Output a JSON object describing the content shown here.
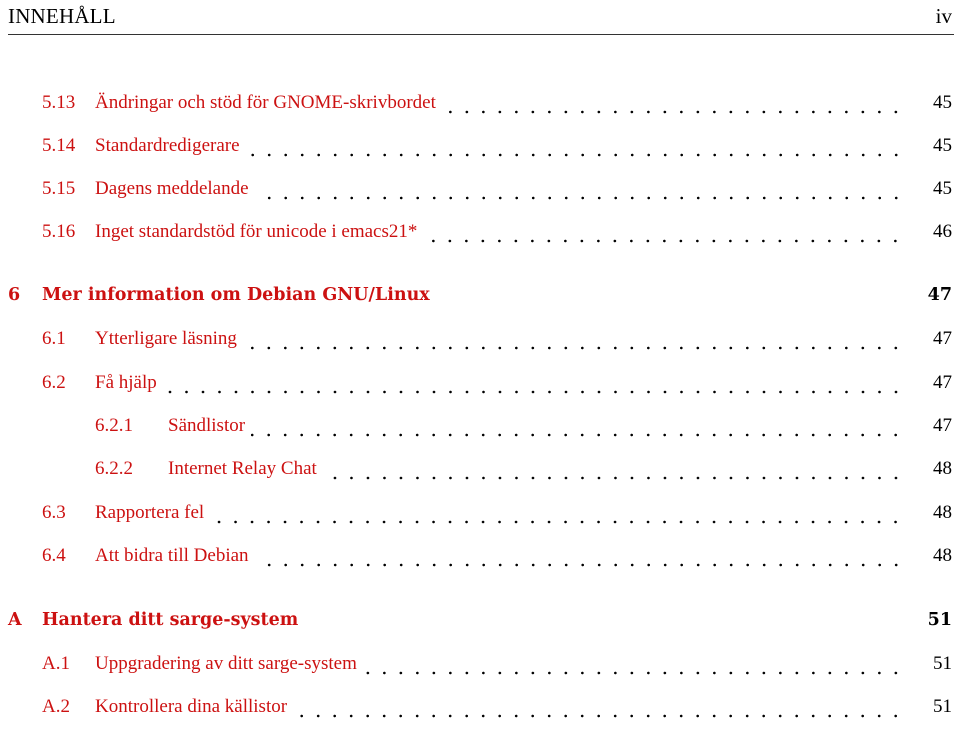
{
  "header": {
    "left": "INNEHÅLL",
    "right": "iv"
  },
  "toc": [
    {
      "level": "section",
      "num": "5.13",
      "title": "Ändringar och stöd för GNOME-skrivbordet",
      "page": "45"
    },
    {
      "level": "section",
      "num": "5.14",
      "title": "Standardredigerare",
      "page": "45"
    },
    {
      "level": "section",
      "num": "5.15",
      "title": "Dagens meddelande",
      "page": "45"
    },
    {
      "level": "section",
      "num": "5.16",
      "title": "Inget standardstöd för unicode i emacs21*",
      "page": "46"
    },
    {
      "level": "chapter",
      "num": "6",
      "title": "Mer information om Debian GNU/Linux",
      "page": "47"
    },
    {
      "level": "section",
      "num": "6.1",
      "title": "Ytterligare läsning",
      "page": "47"
    },
    {
      "level": "section",
      "num": "6.2",
      "title": "Få hjälp",
      "page": "47"
    },
    {
      "level": "subsection",
      "num": "6.2.1",
      "title": "Sändlistor",
      "page": "47"
    },
    {
      "level": "subsection",
      "num": "6.2.2",
      "title": "Internet Relay Chat",
      "page": "48"
    },
    {
      "level": "section",
      "num": "6.3",
      "title": "Rapportera fel",
      "page": "48"
    },
    {
      "level": "section",
      "num": "6.4",
      "title": "Att bidra till Debian",
      "page": "48"
    },
    {
      "level": "chapter",
      "num": "A",
      "title": "Hantera ditt sarge-system",
      "page": "51"
    },
    {
      "level": "section",
      "num": "A.1",
      "title": "Uppgradering av ditt sarge-system",
      "page": "51"
    },
    {
      "level": "section",
      "num": "A.2",
      "title": "Kontrollera dina källistor",
      "page": "51"
    }
  ]
}
